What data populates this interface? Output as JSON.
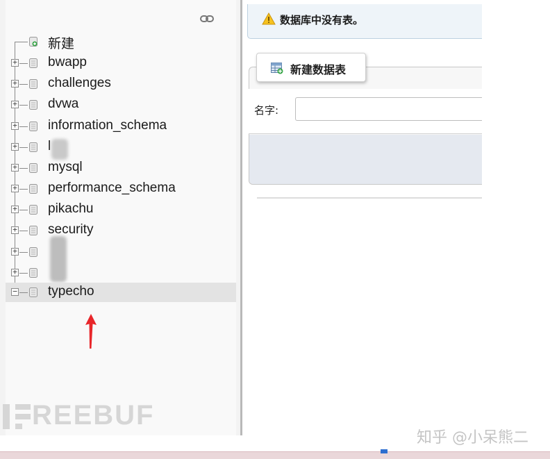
{
  "sidebar": {
    "new_label": "新建",
    "databases": [
      {
        "label": "bwapp"
      },
      {
        "label": "challenges"
      },
      {
        "label": "dvwa"
      },
      {
        "label": "information_schema"
      },
      {
        "label": "l"
      },
      {
        "label": "mysql"
      },
      {
        "label": "performance_schema"
      },
      {
        "label": "pikachu"
      },
      {
        "label": "security"
      },
      {
        "label": ""
      },
      {
        "label": ""
      },
      {
        "label": "typecho"
      }
    ],
    "selected_database": "typecho"
  },
  "notice": {
    "icon": "warning-icon",
    "text": "数据库中没有表。"
  },
  "create_table": {
    "legend_icon": "table-icon",
    "legend": "新建数据表",
    "name_label": "名字:",
    "name_value": ""
  },
  "watermarks": {
    "left": "REEBUF",
    "right": "知乎 @小呆熊二"
  },
  "colors": {
    "notice_bg": "#eef4f9",
    "selected_row_bg": "#e3e3e3",
    "arrow": "#e8262a"
  }
}
